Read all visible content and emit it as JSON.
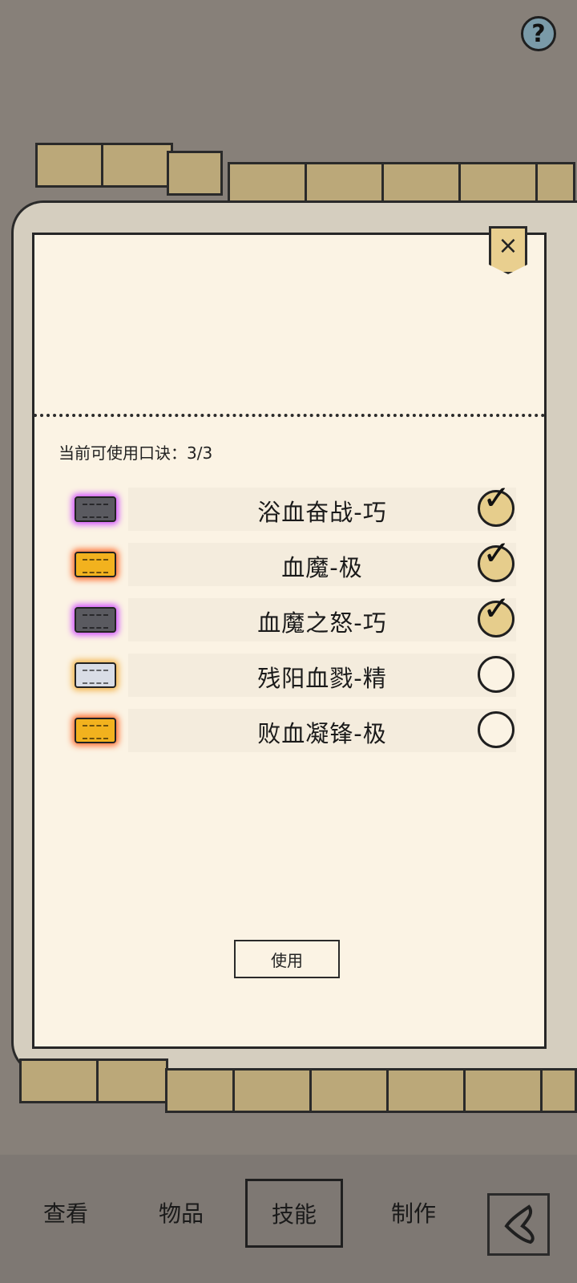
{
  "header": {
    "help_icon": "question-mark-icon",
    "help_label": "?"
  },
  "dialog": {
    "close_icon": "close-icon",
    "close_label": "×",
    "count_label": "当前可使用口诀：3/3",
    "skills": [
      {
        "name": "浴血奋战-巧",
        "checked": true,
        "scroll_color": "#5a5a60",
        "glow": "#d04cff"
      },
      {
        "name": "血魔-极",
        "checked": true,
        "scroll_color": "#f2b21e",
        "glow": "#ff6a2a"
      },
      {
        "name": "血魔之怒-巧",
        "checked": true,
        "scroll_color": "#5a5a60",
        "glow": "#d04cff"
      },
      {
        "name": "残阳血戮-精",
        "checked": false,
        "scroll_color": "#d9dde6",
        "glow": "#f3b44a"
      },
      {
        "name": "败血凝锋-极",
        "checked": false,
        "scroll_color": "#f2b21e",
        "glow": "#ff6a2a"
      }
    ],
    "use_button": "使用"
  },
  "bottom_nav": {
    "items": [
      {
        "label": "查看",
        "active": false
      },
      {
        "label": "物品",
        "active": false
      },
      {
        "label": "技能",
        "active": true
      },
      {
        "label": "制作",
        "active": false
      }
    ],
    "back_icon": "back-arrow-icon"
  }
}
